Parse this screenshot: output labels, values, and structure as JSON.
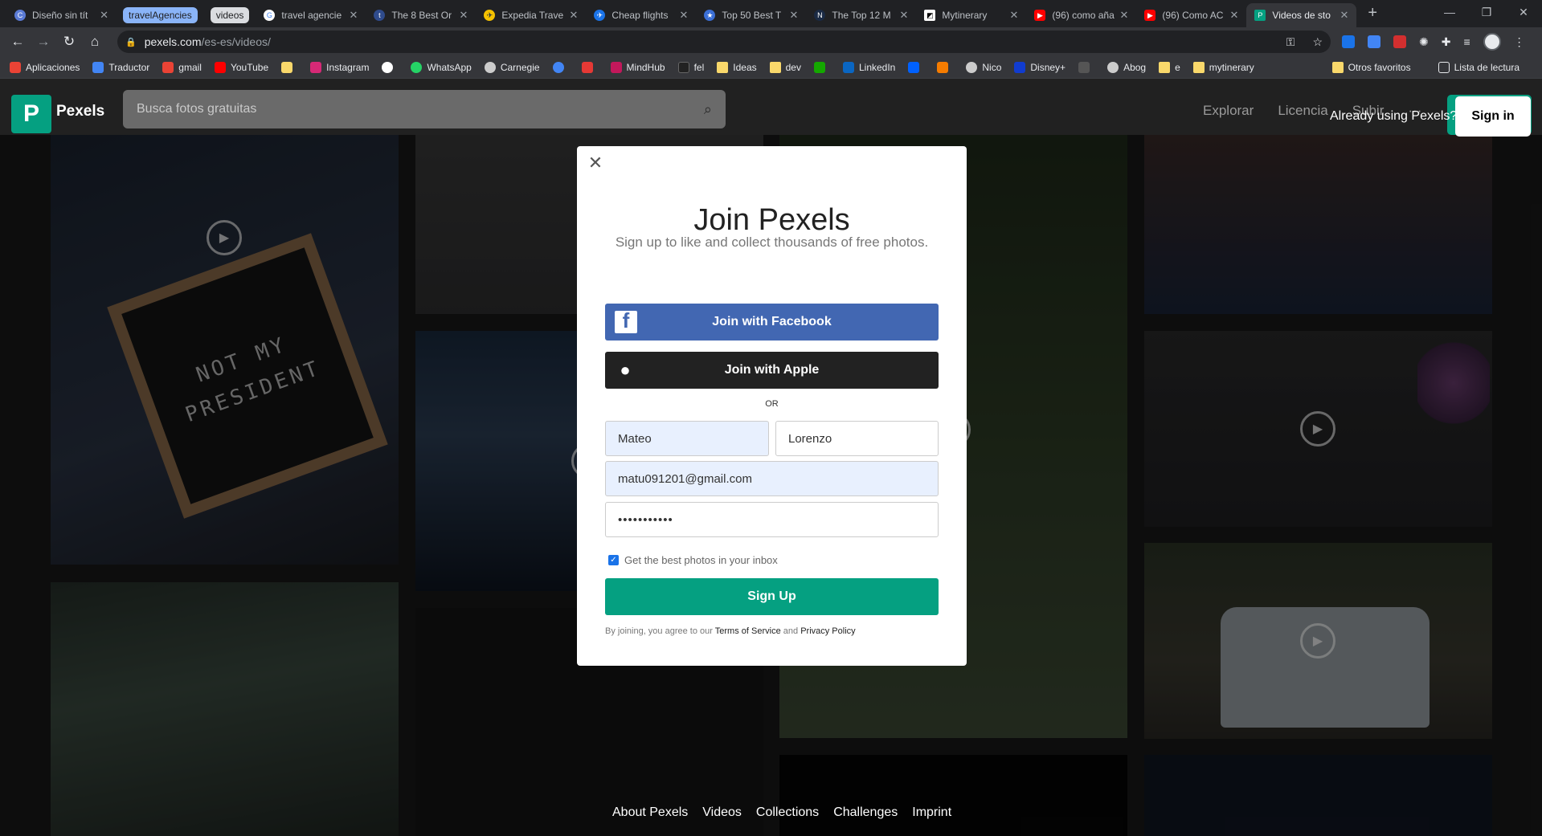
{
  "browser": {
    "tabs": [
      {
        "title": "Diseño sin tít",
        "color": "#5b7bd5",
        "glyph": "C"
      },
      {
        "title": "travel agencie",
        "color": "#ffffff",
        "glyph": "G"
      },
      {
        "title": "The 8 Best Or",
        "color": "#2f4b8c",
        "glyph": "t"
      },
      {
        "title": "Expedia Trave",
        "color": "#f6c200",
        "glyph": "✈"
      },
      {
        "title": "Cheap flights",
        "color": "#1a73e8",
        "glyph": "✈"
      },
      {
        "title": "Top 50 Best T",
        "color": "#3b6fd6",
        "glyph": "★"
      },
      {
        "title": "The Top 12 M",
        "color": "#1a2a44",
        "glyph": "N"
      },
      {
        "title": "Mytinerary",
        "color": "#ffffff",
        "glyph": "◩"
      },
      {
        "title": "(96) como aña",
        "color": "#ff0000",
        "glyph": "▶"
      },
      {
        "title": "(96) Como AC",
        "color": "#ff0000",
        "glyph": "▶"
      },
      {
        "title": "Videos de sto",
        "color": "#05a081",
        "glyph": "P"
      }
    ],
    "groups": [
      {
        "label": "travelAgencies",
        "color": "#8ab4f8",
        "text": "#202124"
      },
      {
        "label": "videos",
        "color": "#dadce0",
        "text": "#202124"
      }
    ],
    "new_tab": "+",
    "window_controls": {
      "minimize": "—",
      "restore": "❐",
      "close": "✕"
    },
    "url_host": "pexels.com",
    "url_path": "/es-es/videos/",
    "bookmarks": [
      {
        "label": "Aplicaciones",
        "color": "#ea4335"
      },
      {
        "label": "Traductor",
        "color": "#4285f4"
      },
      {
        "label": "gmail",
        "color": "#ea4335"
      },
      {
        "label": "YouTube",
        "color": "#ff0000"
      },
      {
        "label": "",
        "color": "#f9d86b"
      },
      {
        "label": "Instagram",
        "color": "#d62976"
      },
      {
        "label": "",
        "color": "#ffffff"
      },
      {
        "label": "WhatsApp",
        "color": "#25d366"
      },
      {
        "label": "Carnegie",
        "color": "#cccccc"
      },
      {
        "label": "",
        "color": "#4285f4"
      },
      {
        "label": "",
        "color": "#e53935"
      },
      {
        "label": "MindHub",
        "color": "#c2185b"
      },
      {
        "label": "fel",
        "color": "#222222"
      },
      {
        "label": "Ideas",
        "color": "#f9d86b"
      },
      {
        "label": "dev",
        "color": "#f9d86b"
      },
      {
        "label": "",
        "color": "#14a800"
      },
      {
        "label": "LinkedIn",
        "color": "#0a66c2"
      },
      {
        "label": "",
        "color": "#0061ff"
      },
      {
        "label": "",
        "color": "#f57c00"
      },
      {
        "label": "Nico",
        "color": "#cccccc"
      },
      {
        "label": "Disney+",
        "color": "#113ccf"
      },
      {
        "label": "",
        "color": "#555555"
      },
      {
        "label": "Abog",
        "color": "#cccccc"
      },
      {
        "label": "e",
        "color": "#f9d86b"
      },
      {
        "label": "mytinerary",
        "color": "#f9d86b"
      }
    ],
    "bookmarks_right": [
      "Otros favoritos",
      "Lista de lectura"
    ]
  },
  "pexels": {
    "brand": "Pexels",
    "search_placeholder": "Busca fotos gratuitas",
    "nav": [
      "Explorar",
      "Licencia",
      "Subir",
      "···"
    ],
    "already": "Already using Pexels?",
    "sign_in": "Sign in",
    "footer": [
      "About Pexels",
      "Videos",
      "Collections",
      "Challenges",
      "Imprint"
    ]
  },
  "modal": {
    "title": "Join Pexels",
    "subtitle": "Sign up to like and collect thousands of free photos.",
    "facebook": "Join with Facebook",
    "apple": "Join with Apple",
    "or": "OR",
    "first_name": "Mateo",
    "last_name": "Lorenzo",
    "email": "matu091201@gmail.com",
    "password_mask": "•••••••••••",
    "newsletter": "Get the best photos in your inbox",
    "newsletter_checked": true,
    "signup": "Sign Up",
    "legal_prefix": "By joining, you agree to our",
    "terms": "Terms of Service",
    "and": "and",
    "privacy": "Privacy Policy"
  },
  "tile_text": {
    "board": "NOT MY PRESIDENT"
  }
}
